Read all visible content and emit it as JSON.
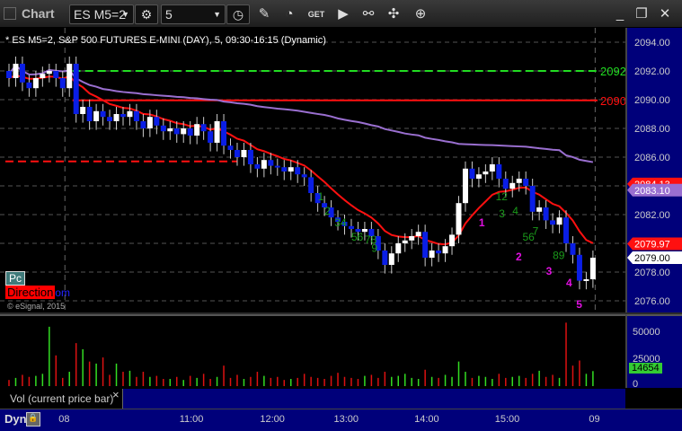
{
  "window": {
    "title": "Chart",
    "symbol": "ES M5=2",
    "interval": "5"
  },
  "chart_header": "* ES M5=2, S&P 500 FUTURES E-MINI (DAY), 5, 09:30-16:15 (Dynamic)",
  "overlay": {
    "pc": "Pc",
    "direction": "Direction",
    "om": "om",
    "copyright": "© eSignal, 2015"
  },
  "volume_pane": {
    "label": "Vol (current price bar)",
    "close": "×",
    "current": "14654",
    "ticks": [
      "50000",
      "25000",
      "0"
    ]
  },
  "bottom": {
    "dyn": "Dyn"
  },
  "colors": {
    "up": "#ffffff",
    "down": "#0a1ee6",
    "ma": "#ff1010",
    "vwap": "#9a6fd0",
    "cnt_green": "#1a9a1a",
    "cnt_magenta": "#e010e0"
  },
  "chart_data": {
    "type": "candlestick",
    "ylim": [
      2075.3,
      2094.9
    ],
    "price_ticks": [
      "2094.00",
      "2092.00",
      "2090.00",
      "2088.00",
      "2086.00",
      "2084.00",
      "2082.00",
      "2080.00",
      "2078.00",
      "2076.00"
    ],
    "tick_values": [
      2094,
      2092,
      2090,
      2088,
      2086,
      2084,
      2082,
      2080,
      2078,
      2076
    ],
    "time_labels": [
      {
        "t": "08",
        "bar": 9
      },
      {
        "t": "11:00",
        "bar": 27
      },
      {
        "t": "12:00",
        "bar": 39
      },
      {
        "t": "13:00",
        "bar": 50
      },
      {
        "t": "14:00",
        "bar": 62
      },
      {
        "t": "15:00",
        "bar": 74
      },
      {
        "t": "09",
        "bar": 88
      }
    ],
    "close": [
      2091.5,
      2092.5,
      2091.2,
      2090.8,
      2091.5,
      2091.8,
      2092.0,
      2091.5,
      2090.8,
      2092.5,
      2089.0,
      2089.5,
      2088.5,
      2089.2,
      2088.8,
      2088.5,
      2089.0,
      2088.8,
      2089.2,
      2088.5,
      2088.0,
      2088.8,
      2088.2,
      2087.8,
      2088.0,
      2087.6,
      2088.0,
      2087.5,
      2088.3,
      2087.8,
      2087.0,
      2088.5,
      2086.8,
      2086.5,
      2086.0,
      2086.5,
      2085.5,
      2085.2,
      2085.8,
      2085.4,
      2085.3,
      2085.0,
      2085.3,
      2084.8,
      2084.6,
      2083.5,
      2082.8,
      2082.5,
      2081.8,
      2081.5,
      2081.2,
      2081.0,
      2080.8,
      2081.0,
      2080.5,
      2079.5,
      2078.5,
      2079.3,
      2080.0,
      2080.2,
      2080.5,
      2080.8,
      2079.0,
      2079.5,
      2079.3,
      2079.8,
      2080.6,
      2082.8,
      2085.2,
      2084.5,
      2084.8,
      2085.0,
      2085.5,
      2084.5,
      2083.8,
      2084.2,
      2084.5,
      2084.0,
      2082.2,
      2082.5,
      2081.6,
      2081.3,
      2081.8,
      2080.0,
      2079.2,
      2077.4,
      2077.5,
      2079.0
    ],
    "volume": [
      6000,
      8000,
      11000,
      9000,
      10000,
      12000,
      58000,
      30000,
      8000,
      14000,
      42000,
      36000,
      24000,
      22000,
      28000,
      11000,
      22000,
      14000,
      15000,
      9000,
      14000,
      9000,
      10000,
      7000,
      7000,
      9000,
      6000,
      10000,
      8000,
      12000,
      7000,
      9000,
      20000,
      8000,
      11000,
      7000,
      9000,
      14000,
      10000,
      8000,
      9000,
      6000,
      7000,
      8000,
      12000,
      9000,
      8000,
      7000,
      10000,
      13000,
      9000,
      8000,
      7000,
      10000,
      11000,
      8000,
      14000,
      9000,
      10000,
      12000,
      8000,
      7000,
      16000,
      9000,
      8000,
      11000,
      9000,
      24000,
      14000,
      8000,
      10000,
      9000,
      7000,
      12000,
      8000,
      9000,
      10000,
      8000,
      12000,
      15000,
      9000,
      11000,
      8000,
      62000,
      20000,
      25000,
      12000,
      14654
    ],
    "levels": [
      {
        "price": 2092,
        "label": "2092",
        "color": "#22dd22",
        "dash": true,
        "from_bar": 10
      },
      {
        "price": 2089.95,
        "label": "2090.00",
        "color": "#ff1010",
        "dash": false,
        "from_bar": 10
      },
      {
        "price": 2085.7,
        "label": "",
        "color": "#ff1010",
        "dash": true,
        "from_bar": 0,
        "to_bar": 34
      }
    ],
    "price_flags": [
      {
        "label": "2084.13",
        "price": 2084.13,
        "bg": "#ff1010",
        "fg": "#fff"
      },
      {
        "label": "2083.10",
        "price": 2083.7,
        "bg": "#9a6fd0",
        "fg": "#fff"
      },
      {
        "label": "2079.97",
        "price": 2079.97,
        "bg": "#ff1010",
        "fg": "#fff"
      },
      {
        "label": "2079.00",
        "price": 2079.0,
        "bg": "#fff",
        "fg": "#000"
      }
    ],
    "counts_green": [
      {
        "t": "1",
        "bar": 46,
        "p": 2083.0
      },
      {
        "t": "2",
        "bar": 47,
        "p": 2082.0
      },
      {
        "t": "34",
        "bar": 48.5,
        "p": 2081.2
      },
      {
        "t": "56",
        "bar": 51,
        "p": 2080.2
      },
      {
        "t": "78",
        "bar": 53,
        "p": 2080.0
      },
      {
        "t": "9",
        "bar": 54,
        "p": 2079.4
      },
      {
        "t": "12",
        "bar": 72.5,
        "p": 2083.0
      },
      {
        "t": "3",
        "bar": 73,
        "p": 2081.8
      },
      {
        "t": "4",
        "bar": 75,
        "p": 2082.0
      },
      {
        "t": "56",
        "bar": 76.5,
        "p": 2080.2
      },
      {
        "t": "7",
        "bar": 78,
        "p": 2080.6
      },
      {
        "t": "89",
        "bar": 81,
        "p": 2078.9
      }
    ],
    "counts_magenta": [
      {
        "t": "1",
        "bar": 70,
        "p": 2081.2
      },
      {
        "t": "2",
        "bar": 75.5,
        "p": 2078.8
      },
      {
        "t": "3",
        "bar": 80,
        "p": 2077.8
      },
      {
        "t": "4",
        "bar": 83,
        "p": 2077.0
      },
      {
        "t": "5",
        "bar": 84.5,
        "p": 2075.5
      }
    ]
  }
}
